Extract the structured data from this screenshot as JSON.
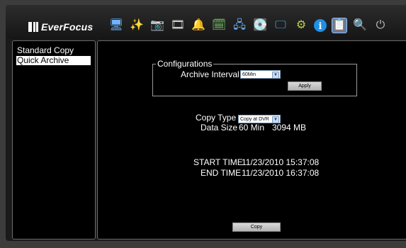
{
  "brand": {
    "logo_text": "EverFocus"
  },
  "toolbar": {
    "icons": [
      {
        "name": "monitor-network-icon",
        "glyph": "🖥"
      },
      {
        "name": "wand-sparkle-icon",
        "glyph": "✨"
      },
      {
        "name": "camera-icon",
        "glyph": "📷"
      },
      {
        "name": "film-reel-icon",
        "glyph": "🎞"
      },
      {
        "name": "alarm-bell-icon",
        "glyph": "🔔"
      },
      {
        "name": "schedule-icon",
        "glyph": "🗓"
      },
      {
        "name": "network-icon",
        "glyph": "🖧"
      },
      {
        "name": "disk-icon",
        "glyph": "💽"
      },
      {
        "name": "display-icon",
        "glyph": "🖵"
      },
      {
        "name": "system-gears-icon",
        "glyph": "⚙"
      },
      {
        "name": "info-icon",
        "glyph": "ℹ"
      },
      {
        "name": "copy-archive-icon",
        "glyph": "📋"
      },
      {
        "name": "log-search-icon",
        "glyph": "🔍"
      },
      {
        "name": "power-icon",
        "glyph": "⏻"
      }
    ]
  },
  "sidebar": {
    "items": [
      {
        "label": "Standard Copy"
      },
      {
        "label": "Quick Archive"
      }
    ]
  },
  "configurations": {
    "legend": "Configurations",
    "archive_interval_label": "Archive Interval",
    "archive_interval_value": "60Min",
    "apply_label": "Apply"
  },
  "copy": {
    "copy_type_label": "Copy Type",
    "copy_type_value": "Copy at DVR",
    "data_size_label": "Data Size",
    "data_size_value": "60 Min",
    "data_size_mb": "3094 MB",
    "start_time_label": "START TIME",
    "start_time_value": "11/23/2010 15:37:08",
    "end_time_label": "END TIME",
    "end_time_value": "11/23/2010 16:37:08",
    "copy_label": "Copy"
  },
  "colors": {
    "panel_bg": "#000000",
    "frame_bg": "#3c3c3c",
    "selected_bg": "#ffffff",
    "active_tool": "#5a7fb0"
  }
}
